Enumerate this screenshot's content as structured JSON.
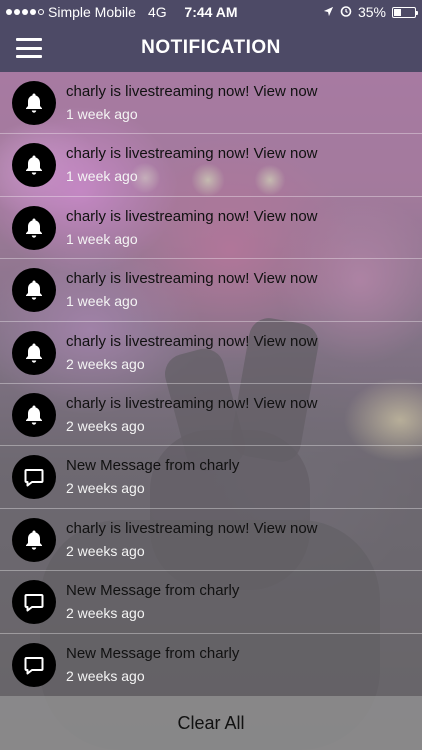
{
  "status_bar": {
    "carrier": "Simple Mobile",
    "network": "4G",
    "time": "7:44 AM",
    "battery_percent": "35%",
    "battery_level": 0.35,
    "signal_dots": 4
  },
  "header": {
    "title": "NOTIFICATION",
    "menu_icon": "hamburger-menu-icon"
  },
  "notifications": [
    {
      "icon": "bell-icon",
      "title": "charly is livestreaming now! View now",
      "time": "1 week ago"
    },
    {
      "icon": "bell-icon",
      "title": "charly is livestreaming now! View now",
      "time": "1 week ago"
    },
    {
      "icon": "bell-icon",
      "title": "charly is livestreaming now! View now",
      "time": "1 week ago"
    },
    {
      "icon": "bell-icon",
      "title": "charly is livestreaming now! View now",
      "time": "1 week ago"
    },
    {
      "icon": "bell-icon",
      "title": "charly is livestreaming now! View now",
      "time": "2 weeks ago"
    },
    {
      "icon": "bell-icon",
      "title": "charly is livestreaming now! View now",
      "time": "2 weeks ago"
    },
    {
      "icon": "message-icon",
      "title": "New Message from charly",
      "time": "2 weeks ago"
    },
    {
      "icon": "bell-icon",
      "title": "charly is livestreaming now! View now",
      "time": "2 weeks ago"
    },
    {
      "icon": "message-icon",
      "title": "New Message from charly",
      "time": "2 weeks ago"
    },
    {
      "icon": "message-icon",
      "title": "New Message from charly",
      "time": "2 weeks ago"
    }
  ],
  "footer": {
    "clear_label": "Clear All"
  },
  "colors": {
    "header_bg": "#4d4a66",
    "icon_circle": "#000000"
  }
}
